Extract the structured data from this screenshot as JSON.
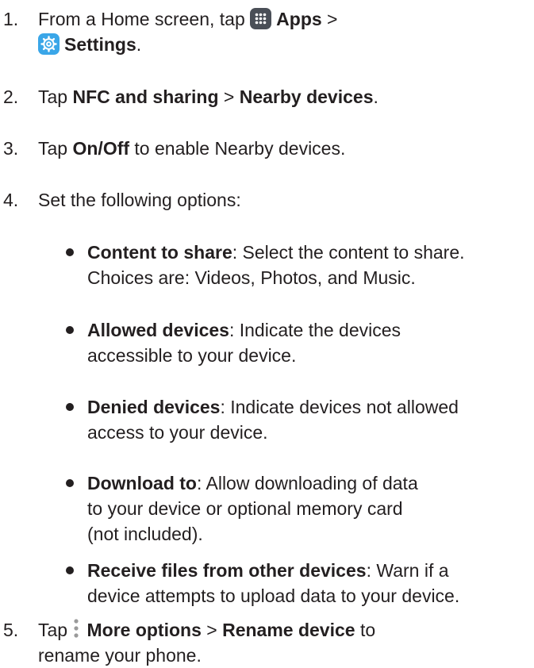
{
  "steps": [
    {
      "number": "1.",
      "line1_prefix": "From a Home screen, tap ",
      "apps_icon": "apps-grid-icon",
      "apps_label": "Apps",
      "sep": " >",
      "settings_icon": "settings-gear-icon",
      "settings_label": "Settings",
      "end": "."
    },
    {
      "number": "2.",
      "prefix": "Tap ",
      "bold1": "NFC and sharing",
      "sep": " > ",
      "bold2": "Nearby devices",
      "end": "."
    },
    {
      "number": "3.",
      "prefix": "Tap ",
      "bold1": "On/Off",
      "rest": " to enable Nearby devices."
    },
    {
      "number": "4.",
      "text": "Set the following options:"
    },
    {
      "number": "5.",
      "prefix": "Tap ",
      "more_icon": "more-options-icon",
      "bold1": "More options",
      "sep": " > ",
      "bold2": "Rename device",
      "rest_line1": " to",
      "rest_line2": "rename your phone."
    }
  ],
  "options": [
    {
      "term": "Content to share",
      "line1": ": Select the content to share.",
      "line2": "Choices are: Videos, Photos, and Music."
    },
    {
      "term": "Allowed devices",
      "line1": ": Indicate the devices",
      "line2": "accessible to your device."
    },
    {
      "term": "Denied devices",
      "line1": ": Indicate devices not allowed",
      "line2": "access to your device."
    },
    {
      "term": "Download to",
      "line1": ": Allow downloading of data",
      "line2": "to your device or optional memory card",
      "line3": "(not included)."
    },
    {
      "term": "Receive files from other devices",
      "line1": ": Warn if a",
      "line2": "device attempts to upload data to your device."
    }
  ],
  "colors": {
    "text": "#231f20",
    "apps_icon_bg": "#4a4f57",
    "settings_icon_bg": "#3aa6e8"
  }
}
